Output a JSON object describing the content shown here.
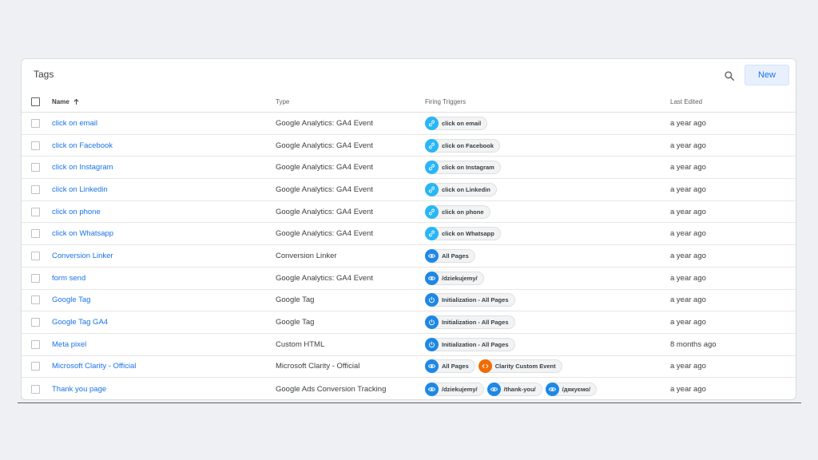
{
  "header": {
    "title": "Tags",
    "new_label": "New"
  },
  "columns": {
    "name": "Name",
    "type": "Type",
    "triggers": "Firing Triggers",
    "last_edited": "Last Edited"
  },
  "icon_colors": {
    "link": "#29b6f6",
    "eye": "#1e88e5",
    "power": "#1e88e5",
    "code": "#ef6c00"
  },
  "rows": [
    {
      "name": "click on email",
      "type": "Google Analytics: GA4 Event",
      "triggers": [
        {
          "icon": "link",
          "label": "click on email"
        }
      ],
      "last_edited": "a year ago"
    },
    {
      "name": "click on Facebook",
      "type": "Google Analytics: GA4 Event",
      "triggers": [
        {
          "icon": "link",
          "label": "click on Facebook"
        }
      ],
      "last_edited": "a year ago"
    },
    {
      "name": "click on Instagram",
      "type": "Google Analytics: GA4 Event",
      "triggers": [
        {
          "icon": "link",
          "label": "click on Instagram"
        }
      ],
      "last_edited": "a year ago"
    },
    {
      "name": "click on Linkedin",
      "type": "Google Analytics: GA4 Event",
      "triggers": [
        {
          "icon": "link",
          "label": "click on Linkedin"
        }
      ],
      "last_edited": "a year ago"
    },
    {
      "name": "click on phone",
      "type": "Google Analytics: GA4 Event",
      "triggers": [
        {
          "icon": "link",
          "label": "click on phone"
        }
      ],
      "last_edited": "a year ago"
    },
    {
      "name": "click on Whatsapp",
      "type": "Google Analytics: GA4 Event",
      "triggers": [
        {
          "icon": "link",
          "label": "click on Whatsapp"
        }
      ],
      "last_edited": "a year ago"
    },
    {
      "name": "Conversion Linker",
      "type": "Conversion Linker",
      "triggers": [
        {
          "icon": "eye",
          "label": "All Pages"
        }
      ],
      "last_edited": "a year ago"
    },
    {
      "name": "form send",
      "type": "Google Analytics: GA4 Event",
      "triggers": [
        {
          "icon": "eye",
          "label": "/dziekujemy/"
        }
      ],
      "last_edited": "a year ago"
    },
    {
      "name": "Google Tag",
      "type": "Google Tag",
      "triggers": [
        {
          "icon": "power",
          "label": "Initialization - All Pages"
        }
      ],
      "last_edited": "a year ago"
    },
    {
      "name": "Google Tag GA4",
      "type": "Google Tag",
      "triggers": [
        {
          "icon": "power",
          "label": "Initialization - All Pages"
        }
      ],
      "last_edited": "a year ago"
    },
    {
      "name": "Meta pixel",
      "type": "Custom HTML",
      "triggers": [
        {
          "icon": "power",
          "label": "Initialization - All Pages"
        }
      ],
      "last_edited": "8 months ago"
    },
    {
      "name": "Microsoft Clarity - Official",
      "type": "Microsoft Clarity - Official",
      "triggers": [
        {
          "icon": "eye",
          "label": "All Pages"
        },
        {
          "icon": "code",
          "label": "Clarity Custom Event"
        }
      ],
      "last_edited": "a year ago"
    },
    {
      "name": "Thank you page",
      "type": "Google Ads Conversion Tracking",
      "triggers": [
        {
          "icon": "eye",
          "label": "/dziekujemy/"
        },
        {
          "icon": "eye",
          "label": "/thank-you/"
        },
        {
          "icon": "eye",
          "label": "/дякуємо/"
        }
      ],
      "last_edited": "a year ago"
    }
  ]
}
